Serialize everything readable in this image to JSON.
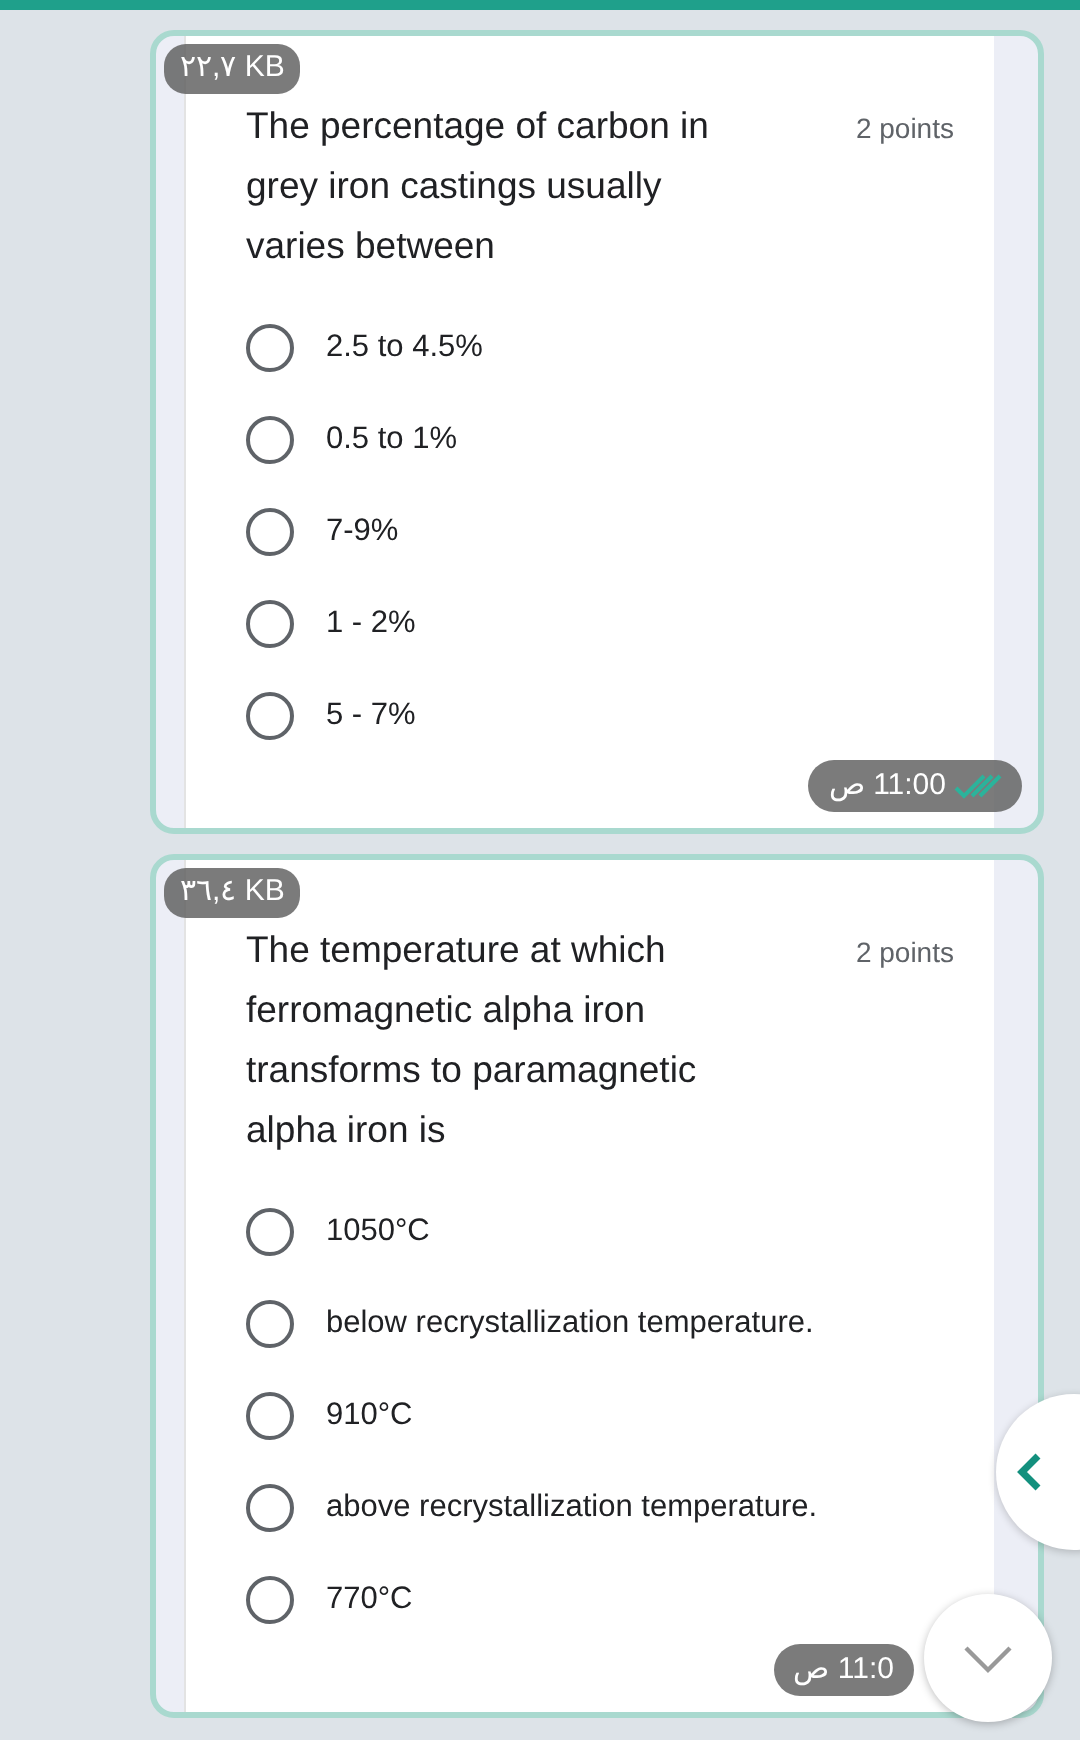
{
  "messages": [
    {
      "file_size": "٢٢,٧ KB",
      "question": "The percentage of carbon in grey iron castings usually varies between",
      "points": "2 points",
      "options": [
        {
          "label": "2.5 to 4.5%",
          "selected": false
        },
        {
          "label": "0.5 to 1%",
          "selected": false
        },
        {
          "label": "7-9%",
          "selected": false
        },
        {
          "label": "1 - 2%",
          "selected": false
        },
        {
          "label": "5 - 7%",
          "selected": false
        }
      ],
      "time": "11:00 ص",
      "read": true
    },
    {
      "file_size": "٣٦,٤ KB",
      "question": "The temperature at which ferromagnetic alpha iron transforms to paramagnetic alpha iron is",
      "points": "2 points",
      "options": [
        {
          "label": "1050°C",
          "selected": false
        },
        {
          "label": "below recrystallization temperature.",
          "selected": false
        },
        {
          "label": "910°C",
          "selected": false
        },
        {
          "label": "above recrystallization temperature.",
          "selected": false
        },
        {
          "label": "770°C",
          "selected": false
        }
      ],
      "time": "11:0 ص",
      "read": false
    }
  ]
}
